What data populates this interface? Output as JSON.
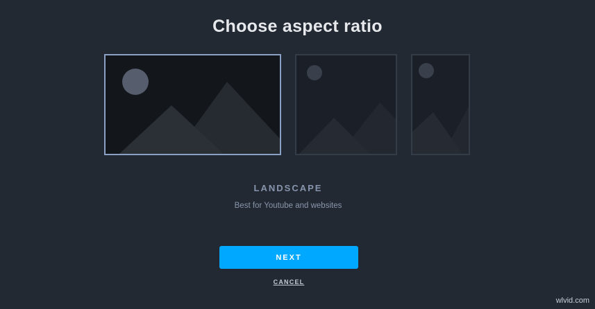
{
  "dialog": {
    "title": "Choose aspect ratio",
    "selected_label": "LANDSCAPE",
    "selected_description": "Best for Youtube and websites",
    "next_label": "NEXT",
    "cancel_label": "CANCEL"
  },
  "options": [
    {
      "id": "landscape",
      "selected": true,
      "icon": "landscape-image-icon"
    },
    {
      "id": "square",
      "selected": false,
      "icon": "square-image-icon"
    },
    {
      "id": "portrait",
      "selected": false,
      "icon": "portrait-image-icon"
    }
  ],
  "colors": {
    "background": "#222933",
    "accent": "#00a8ff",
    "selected_border": "#8aa0c4",
    "unselected_border": "#343c48"
  },
  "watermark": "wlvid.com"
}
